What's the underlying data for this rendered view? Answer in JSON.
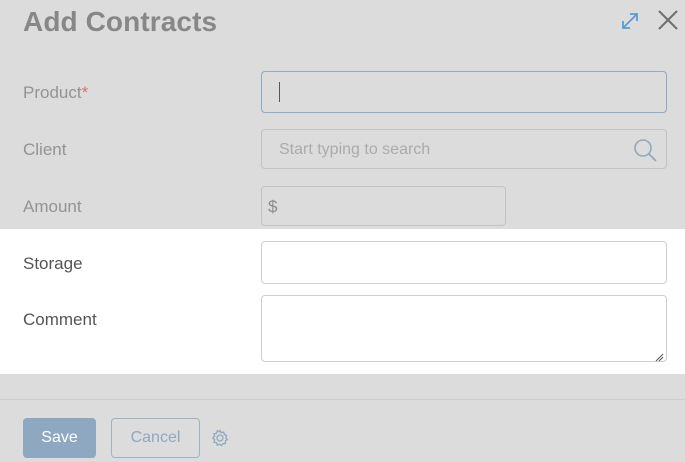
{
  "dialog": {
    "title": "Add Contracts",
    "expand_icon": "expand-arrows-icon",
    "close_icon": "close-icon"
  },
  "form": {
    "product": {
      "label": "Product",
      "required_mark": "*",
      "value": ""
    },
    "client": {
      "label": "Client",
      "placeholder": "Start typing to search",
      "icon": "search-icon"
    },
    "amount": {
      "label": "Amount",
      "currency": "$",
      "value": ""
    },
    "storage": {
      "label": "Storage",
      "value": ""
    },
    "comment": {
      "label": "Comment",
      "value": ""
    }
  },
  "footer": {
    "save_label": "Save",
    "cancel_label": "Cancel",
    "settings_icon": "gear-icon"
  },
  "colors": {
    "accent": "#8ea8c1",
    "required": "#d9756d",
    "overlay": "#dcdcdc"
  }
}
